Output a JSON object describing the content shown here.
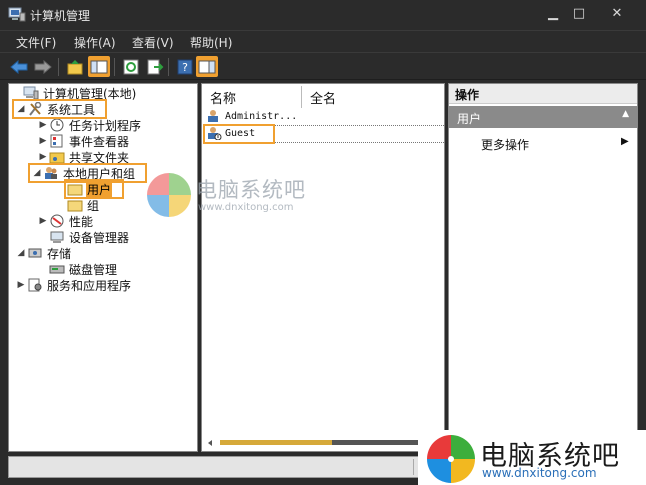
{
  "window": {
    "title": "计算机管理",
    "controls": {
      "minimize": "▁",
      "maximize": "□",
      "close": "✕"
    }
  },
  "menu": [
    {
      "label": "文件(F)"
    },
    {
      "label": "操作(A)"
    },
    {
      "label": "查看(V)"
    },
    {
      "label": "帮助(H)"
    }
  ],
  "toolbar": {
    "icons": [
      "back-arrow-icon",
      "forward-arrow-icon",
      "up-folder-icon",
      "show-tree-icon",
      "refresh-icon",
      "export-icon",
      "help-icon",
      "show-action-pane-icon"
    ]
  },
  "tree": {
    "root": "计算机管理(本地)",
    "system_tools": "系统工具",
    "task_scheduler": "任务计划程序",
    "event_viewer": "事件查看器",
    "shared_folders": "共享文件夹",
    "local_users_groups": "本地用户和组",
    "users": "用户",
    "groups": "组",
    "performance": "性能",
    "device_manager": "设备管理器",
    "storage": "存储",
    "disk_management": "磁盘管理",
    "services_apps": "服务和应用程序"
  },
  "list": {
    "columns": [
      "名称",
      "全名"
    ],
    "rows": [
      {
        "name": "Administr...",
        "fullname": ""
      },
      {
        "name": "Guest",
        "fullname": ""
      }
    ]
  },
  "actions": {
    "header": "操作",
    "section": "用户",
    "items": [
      {
        "label": "更多操作",
        "arrow": "▶"
      }
    ]
  },
  "watermark": {
    "brand": "电脑系统吧",
    "url": "www.dnxitong.com"
  },
  "colors": {
    "highlight": "#f0a030",
    "titlebar": "#2b2b2b"
  }
}
